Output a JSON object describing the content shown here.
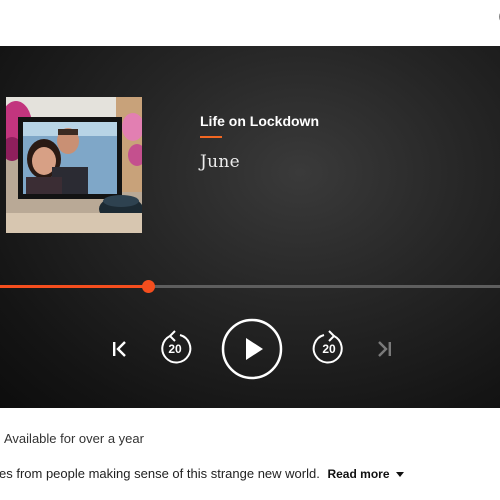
{
  "player": {
    "brand": "Life on Lockdown",
    "episode_title": "June",
    "progress_fraction": 0.295,
    "controls": {
      "skip_back_seconds": "20",
      "skip_forward_seconds": "20"
    },
    "colors": {
      "accent": "#f54e1e",
      "background": "#1a1a1a"
    }
  },
  "meta": {
    "availability": "Available for over a year"
  },
  "description": {
    "text": "es from people making sense of this strange new world.",
    "read_more_label": "Read more"
  }
}
